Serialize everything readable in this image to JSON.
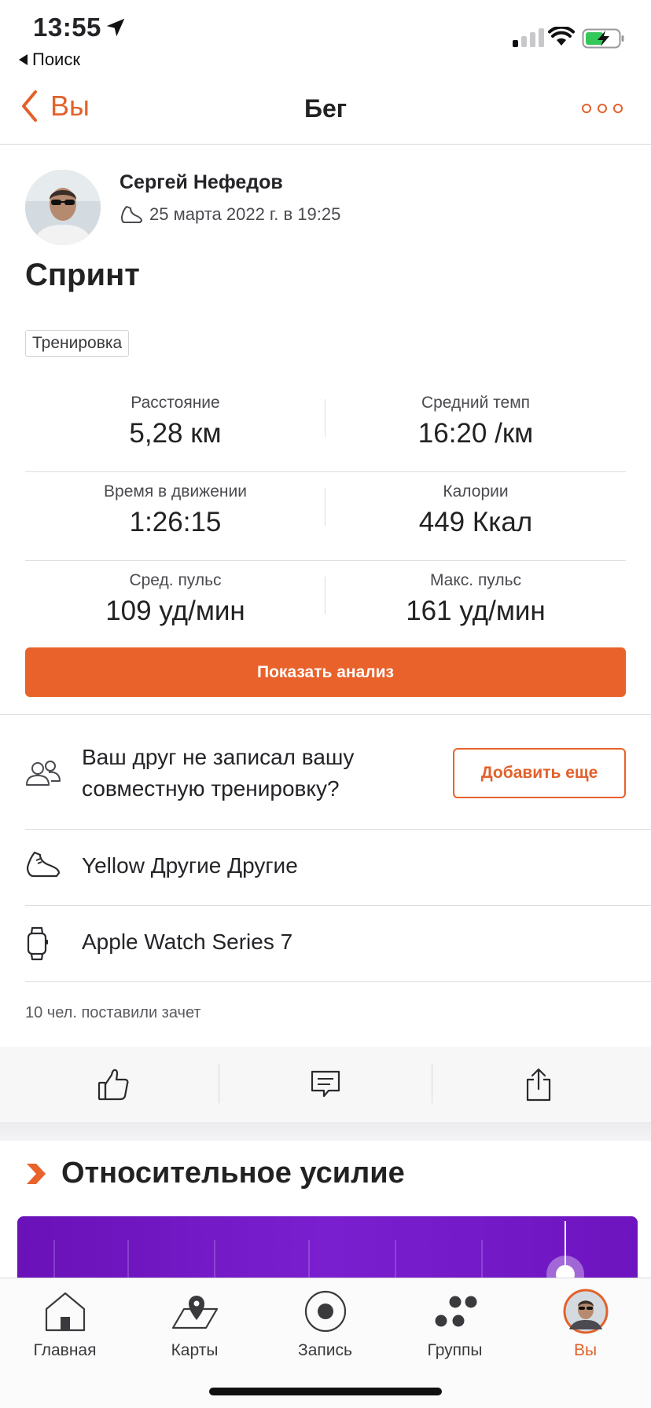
{
  "status_bar": {
    "time": "13:55",
    "back_app": "Поиск"
  },
  "nav": {
    "back_label": "Вы",
    "title": "Бег"
  },
  "activity": {
    "athlete_name": "Сергей Нефедов",
    "date": "25 марта 2022 г. в 19:25",
    "title": "Спринт",
    "tag": "Тренировка"
  },
  "stats": [
    {
      "label": "Расстояние",
      "value": "5,28 км"
    },
    {
      "label": "Средний темп",
      "value": "16:20 /км"
    },
    {
      "label": "Время в движении",
      "value": "1:26:15"
    },
    {
      "label": "Калории",
      "value": "449 Ккал"
    },
    {
      "label": "Сред. пульс",
      "value": "109 уд/мин"
    },
    {
      "label": "Макс. пульс",
      "value": "161 уд/мин"
    }
  ],
  "analysis_button": "Показать анализ",
  "friend": {
    "text": "Ваш друг не записал вашу совместную тренировку?",
    "button": "Добавить еще"
  },
  "gear": {
    "shoes": "Yellow Другие Другие",
    "device": "Apple Watch Series 7"
  },
  "kudos_text": "10 чел. поставили зачет",
  "effort": {
    "title": "Относительное усилие"
  },
  "tabs": [
    {
      "label": "Главная",
      "icon": "home-icon"
    },
    {
      "label": "Карты",
      "icon": "map-icon"
    },
    {
      "label": "Запись",
      "icon": "record-icon"
    },
    {
      "label": "Группы",
      "icon": "groups-icon"
    },
    {
      "label": "Вы",
      "icon": "avatar-icon",
      "active": true
    }
  ],
  "colors": {
    "accent": "#e9622b",
    "effort_purple": "#7a1fcf"
  }
}
